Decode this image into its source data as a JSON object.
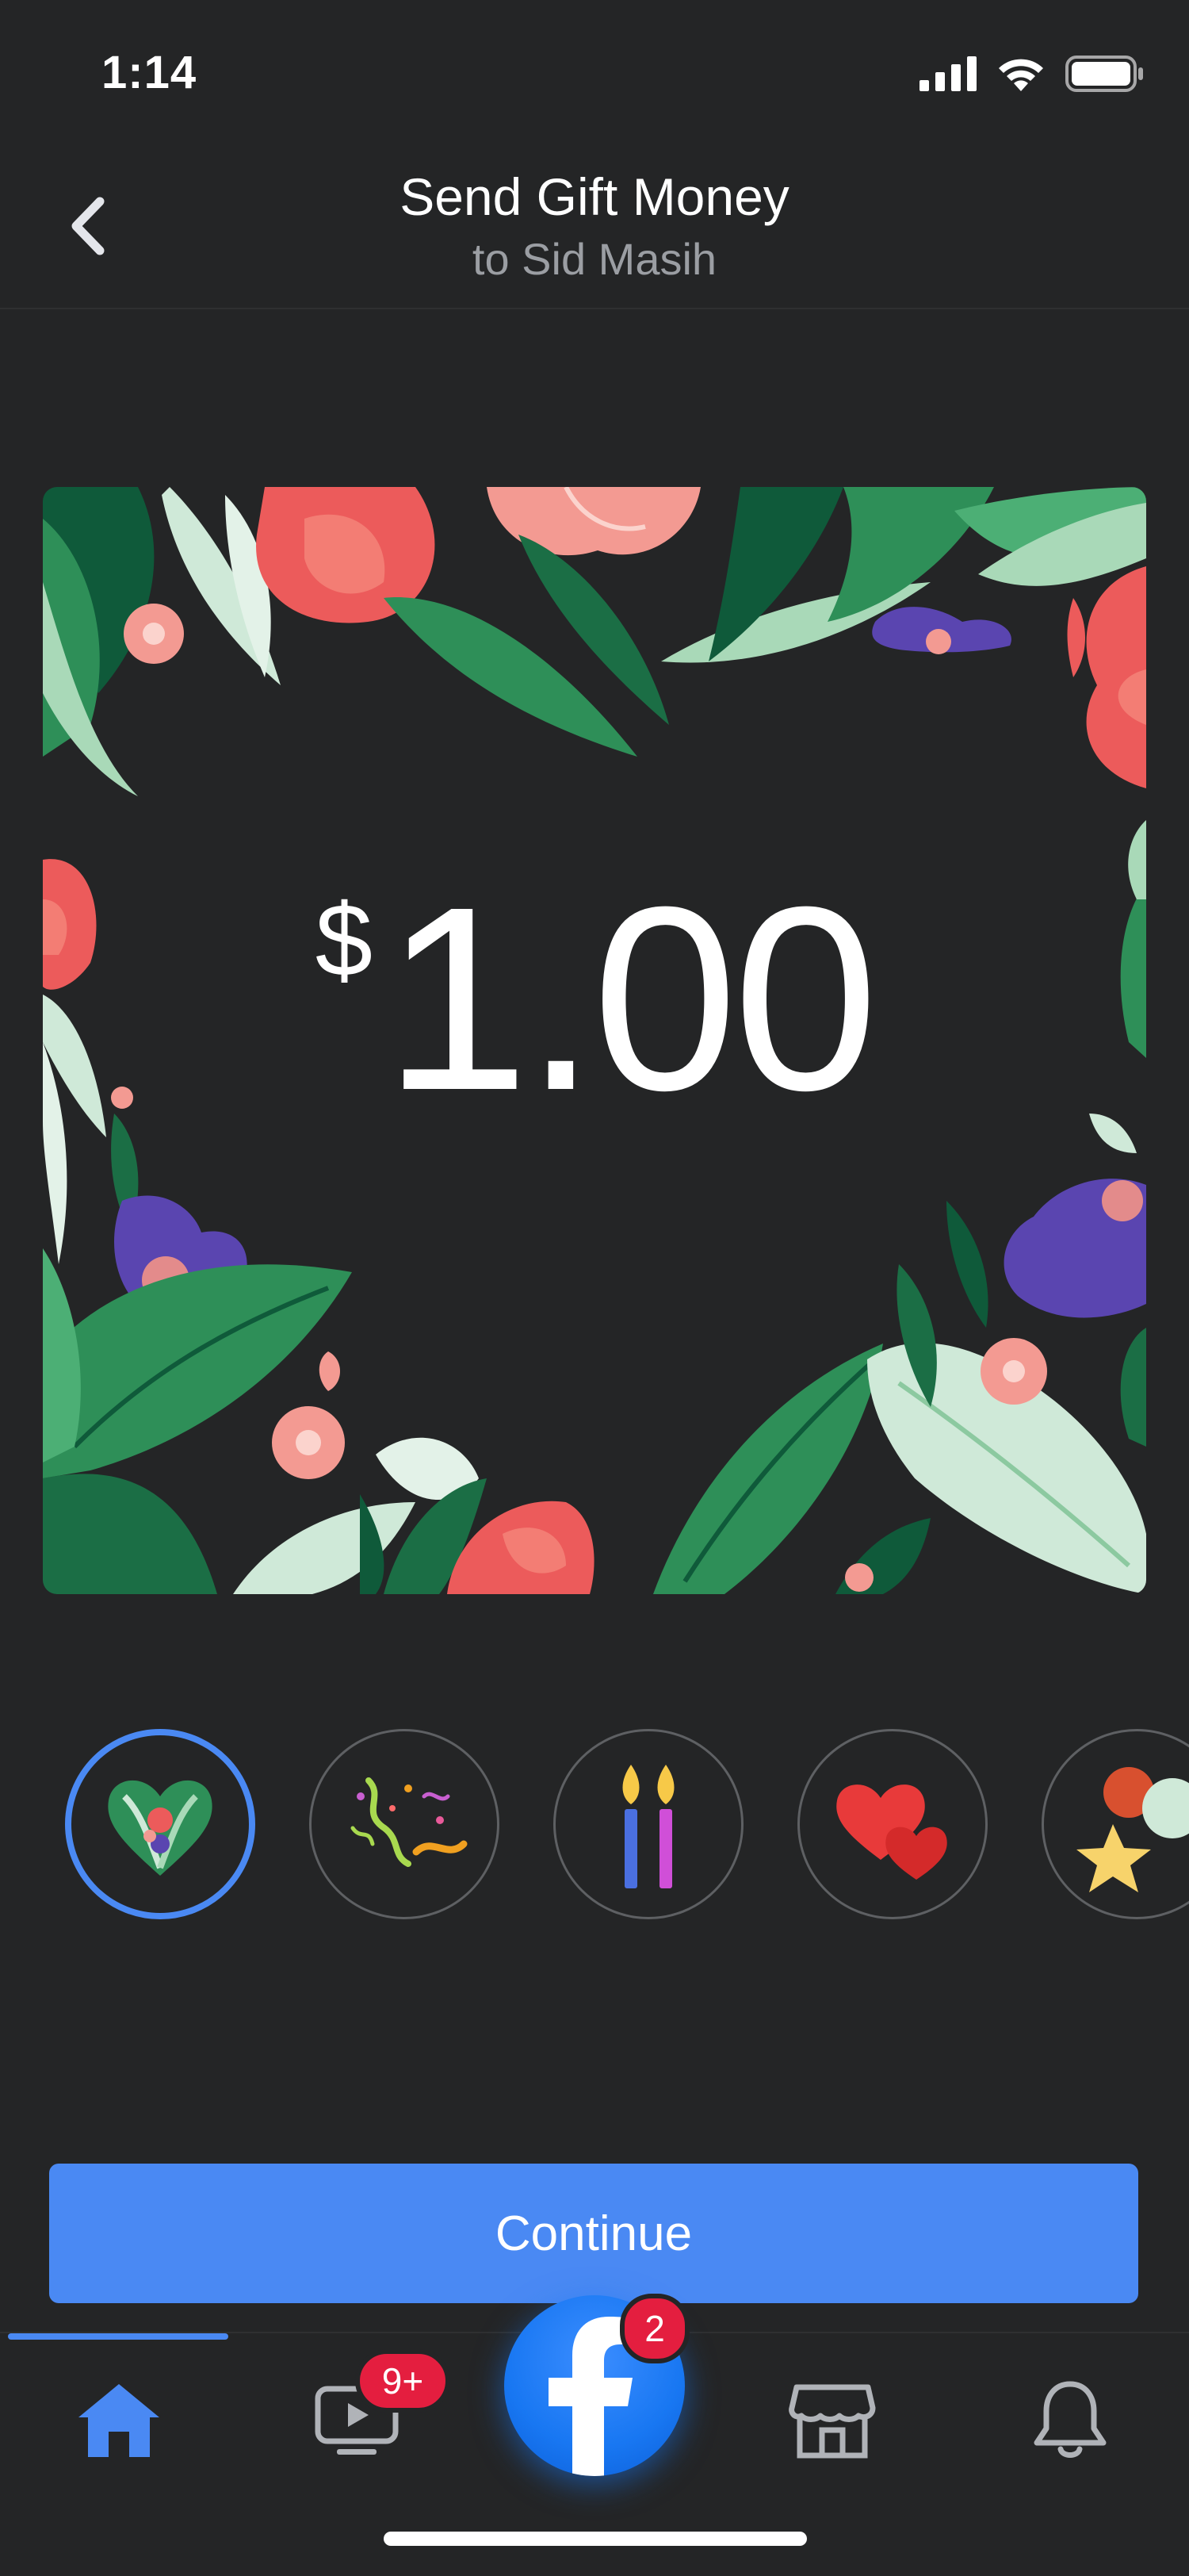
{
  "status_bar": {
    "time": "1:14"
  },
  "header": {
    "title": "Send Gift Money",
    "subtitle": "to Sid Masih"
  },
  "gift": {
    "currency": "$",
    "amount": "1.00"
  },
  "themes": [
    {
      "name": "floral-heart",
      "selected": true
    },
    {
      "name": "confetti",
      "selected": false
    },
    {
      "name": "birthday-candles",
      "selected": false
    },
    {
      "name": "hearts",
      "selected": false
    },
    {
      "name": "balloons-star",
      "selected": false
    }
  ],
  "continue_label": "Continue",
  "tab_bar": {
    "active": "home",
    "watch_badge": "9+",
    "facebook_badge": "2"
  },
  "colors": {
    "background": "#242526",
    "accent": "#4a89f3",
    "badge": "#e41e3f"
  }
}
